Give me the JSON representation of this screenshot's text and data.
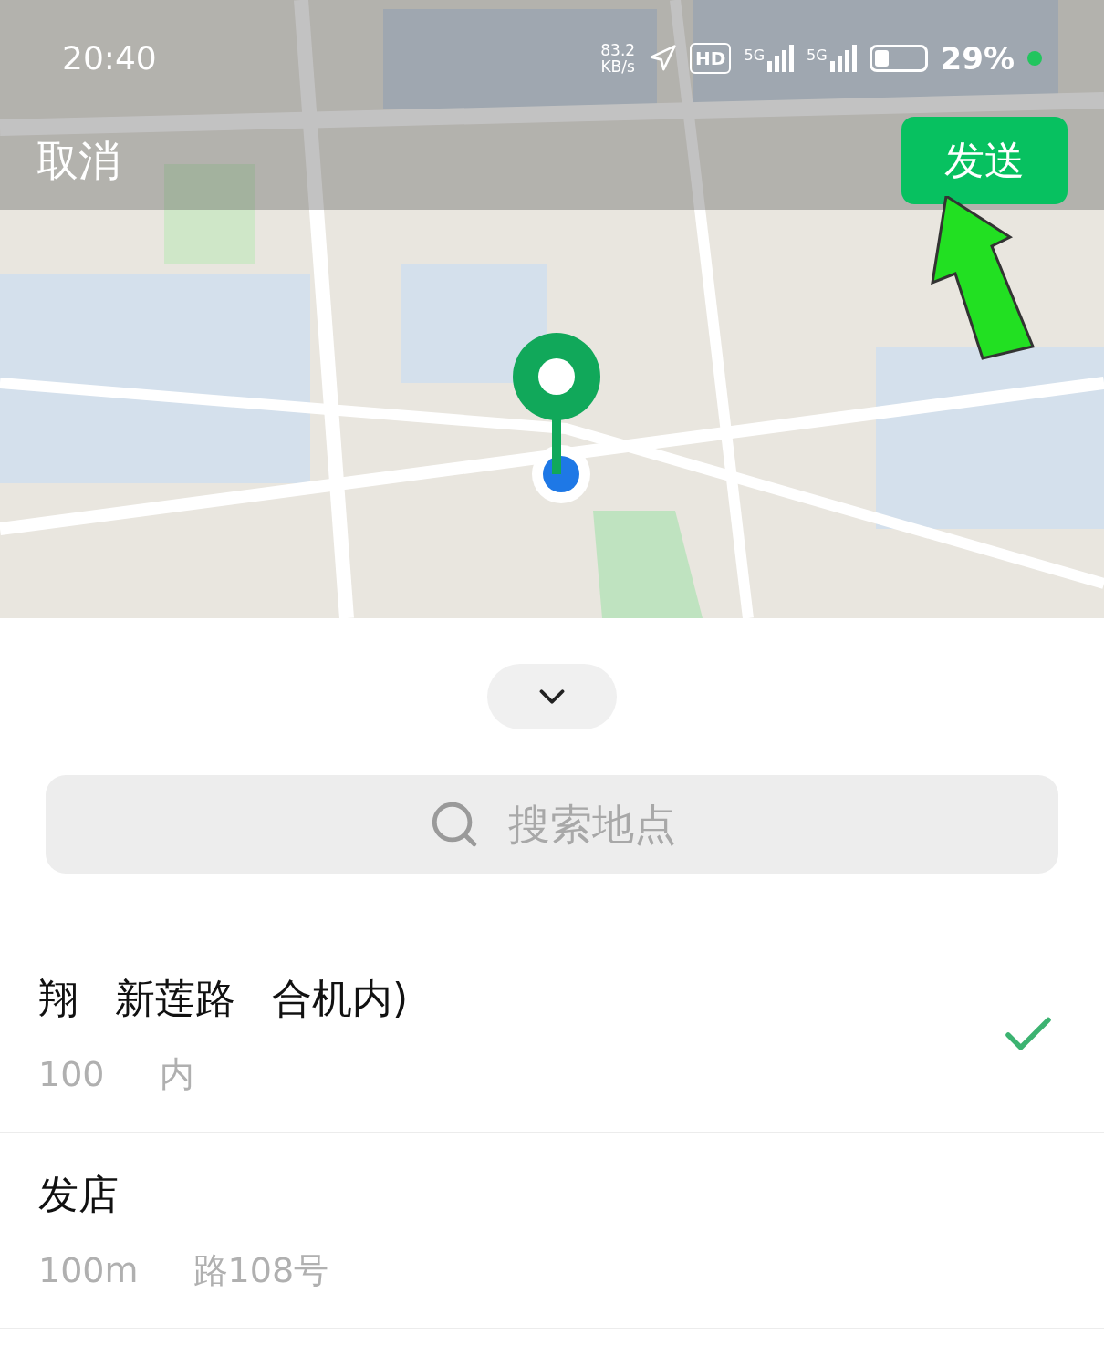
{
  "status_bar": {
    "time": "20:40",
    "net_speed": [
      "83.2",
      "KB/s"
    ],
    "hd": "HD",
    "signals": [
      "5G",
      "5G"
    ],
    "battery": {
      "level": 0.29,
      "text": "29%"
    }
  },
  "header": {
    "cancel": "取消",
    "send": "发送"
  },
  "search": {
    "placeholder": "搜索地点"
  },
  "places": [
    {
      "title": [
        "翔",
        "新莲路",
        "合机内)"
      ],
      "subtitle": [
        "100",
        "内"
      ],
      "selected": true
    },
    {
      "title": [
        "发店"
      ],
      "subtitle": [
        "100m",
        "路108号"
      ],
      "selected": false
    }
  ]
}
